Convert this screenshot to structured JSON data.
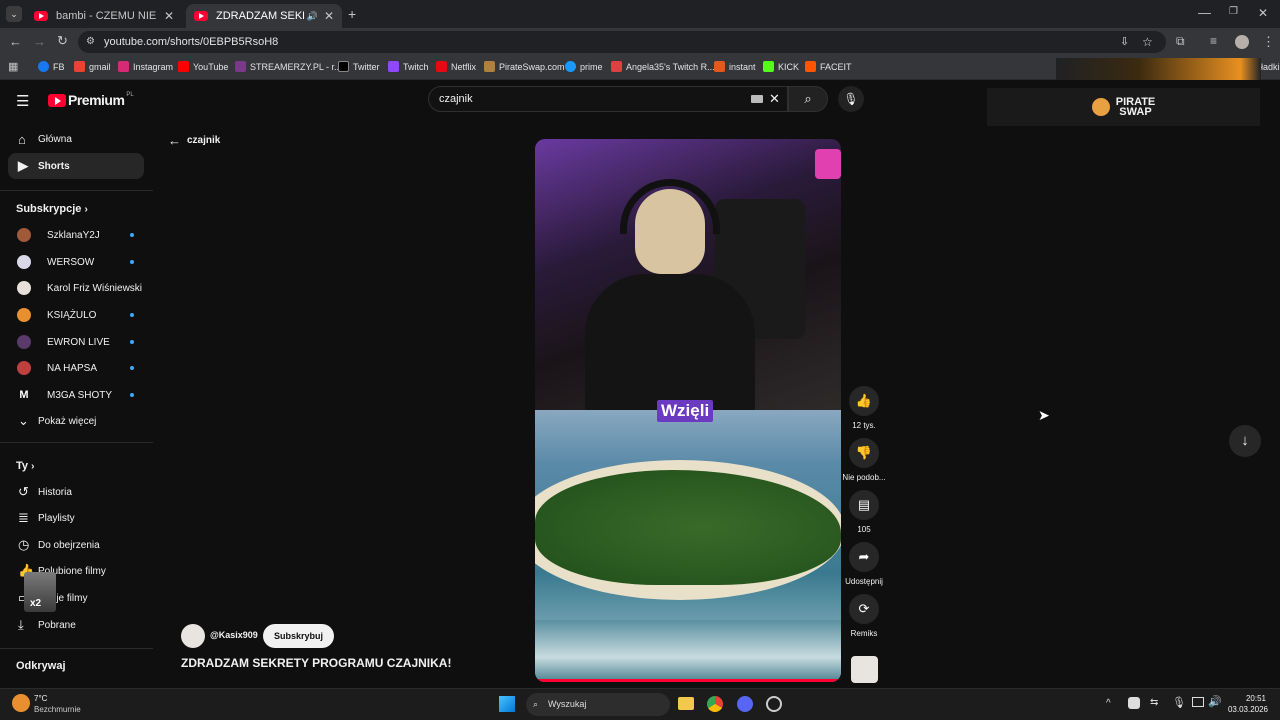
{
  "browser": {
    "tabs": [
      {
        "title": "bambi - CZEMU NIE ŚPISZ? (De"
      },
      {
        "title": "ZDRADZAM SEKRETY PROG"
      }
    ],
    "url": "youtube.com/shorts/0EBPB5RsoH8",
    "bookmarks": [
      "FB",
      "gmail",
      "Instagram",
      "YouTube",
      "STREAMERZY.PL - r...",
      "Twitter",
      "Twitch",
      "Netflix",
      "PirateSwap.com",
      "prime",
      "Angela35's Twitch R...",
      "instant",
      "KICK",
      "FACEIT"
    ],
    "all_bookmarks": "Wszystkie zakładki",
    "colors": {
      "tabbar": "#202124",
      "toolbar": "#35363a"
    }
  },
  "youtube": {
    "logo": "Premium",
    "logo_sup": "PL",
    "search_value": "czajnik",
    "back_label": "czajnik",
    "nav": [
      {
        "label": "Główna",
        "icon": "home-icon"
      },
      {
        "label": "Shorts",
        "icon": "shorts-icon"
      }
    ],
    "subs_header": "Subskrypcje",
    "subscriptions": [
      {
        "name": "SzklanaY2J",
        "color": "#a05a3a",
        "dot": true
      },
      {
        "name": "WERSOW",
        "color": "#d8d8e8",
        "dot": true
      },
      {
        "name": "Karol Friz Wiśniewski",
        "color": "#e8e0d8",
        "dot": false
      },
      {
        "name": "KSIĄŻULO",
        "color": "#e89030",
        "dot": true
      },
      {
        "name": "EWRON LIVE",
        "color": "#5a3a6a",
        "dot": true
      },
      {
        "name": "NA HAPSA",
        "color": "#c04040",
        "dot": true
      },
      {
        "name": "M3GA SHOTY",
        "color": "#ffffff",
        "dot": true
      }
    ],
    "show_more": "Pokaż więcej",
    "you_header": "Ty",
    "you_items": [
      {
        "label": "Historia",
        "icon": "history-icon"
      },
      {
        "label": "Playlisty",
        "icon": "playlist-icon"
      },
      {
        "label": "Do obejrzenia",
        "icon": "clock-icon"
      },
      {
        "label": "Polubione filmy",
        "icon": "like-icon"
      },
      {
        "label": "Twoje filmy",
        "icon": "video-icon"
      },
      {
        "label": "Pobrane",
        "icon": "download-icon"
      }
    ],
    "explore_header": "Odkrywaj",
    "short": {
      "channel": "@Kasix909",
      "subscribe": "Subskrybuj",
      "title": "ZDRADZAM SEKRETY PROGRAMU CZAJNIKA!",
      "caption": "Wzięli",
      "likes": "12 tys.",
      "dislike": "Nie podob...",
      "comments": "105",
      "share": "Udostępnij",
      "remix": "Remiks"
    },
    "ad_brand": [
      "PIRATE",
      "SWAP"
    ],
    "avatar_badge": "x2"
  },
  "taskbar": {
    "weather_temp": "7°C",
    "weather_desc": "Bezchmurnie",
    "search_placeholder": "Wyszukaj",
    "time": "20:51",
    "date": "03.03.2026"
  }
}
